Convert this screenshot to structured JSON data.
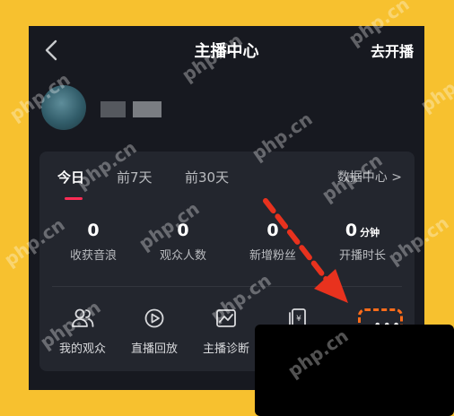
{
  "header": {
    "title": "主播中心",
    "go_live": "去开播"
  },
  "tabs": [
    {
      "label": "今日",
      "active": true
    },
    {
      "label": "前7天"
    },
    {
      "label": "前30天"
    }
  ],
  "data_center": "数据中心 >",
  "stats": [
    {
      "value": "0",
      "label": "收获音浪"
    },
    {
      "value": "0",
      "label": "观众人数"
    },
    {
      "value": "0",
      "label": "新增粉丝"
    },
    {
      "value": "0",
      "unit": "分钟",
      "label": "开播时长"
    }
  ],
  "tools": [
    {
      "label": "我的观众",
      "icon": "audience-icon"
    },
    {
      "label": "直播回放",
      "icon": "replay-icon"
    },
    {
      "label": "主播诊断",
      "icon": "diagnosis-icon"
    },
    {
      "label": "",
      "icon": "income-icon"
    }
  ],
  "more": "•••",
  "watermark": "php.cn",
  "colors": {
    "background": "#f7c12f",
    "panel": "#171920",
    "card": "#23262e",
    "accent": "#fe2c55",
    "annotation": "#ff6c1a"
  }
}
